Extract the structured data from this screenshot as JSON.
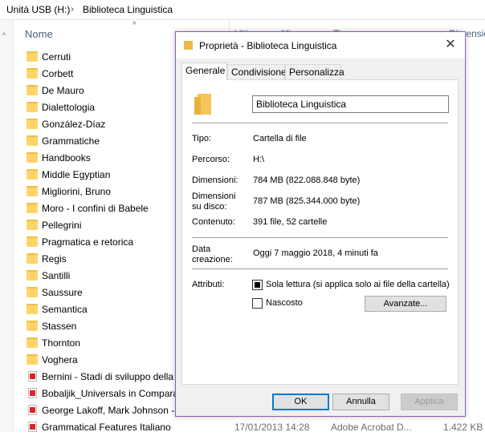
{
  "explorer": {
    "breadcrumb": [
      "Unità USB (H:)",
      "Biblioteca Linguistica"
    ],
    "column_name": "Nome",
    "column_date": "Ultima modifica",
    "column_type": "Tipo",
    "column_size": "Dimensione",
    "folders": [
      "Cerruti",
      "Corbett",
      "De Mauro",
      "Dialettologia",
      "González-Díaz",
      "Grammatiche",
      "Handbooks",
      "Middle Egyptian",
      "Migliorini, Bruno",
      "Moro - I confini di Babele",
      "Pellegrini",
      "Pragmatica e retorica",
      "Regis",
      "Santilli",
      "Saussure",
      "Semantica",
      "Stassen",
      "Thornton",
      "Voghera"
    ],
    "files": [
      {
        "name": "Bernini - Stadi di sviluppo della",
        "date": "",
        "type": "",
        "size": "KB"
      },
      {
        "name": "Bobaljik_Universals in Compara",
        "date": "",
        "type": "",
        "size": "KB"
      },
      {
        "name": "George Lakoff, Mark Johnson -",
        "date": "",
        "type": "",
        "size": "KB"
      },
      {
        "name": "Grammatical Features Italiano",
        "date": "17/01/2013 14:28",
        "type": "Adobe Acrobat D...",
        "size": "1.422 KB"
      }
    ]
  },
  "dialog": {
    "title": "Proprietà - Biblioteca Linguistica",
    "close": "✕",
    "tabs": [
      "Generale",
      "Condivisione",
      "Personalizza"
    ],
    "folder_name": "Biblioteca Linguistica",
    "type_label": "Tipo:",
    "type_value": "Cartella di file",
    "path_label": "Percorso:",
    "path_value": "H:\\",
    "size_label": "Dimensioni:",
    "size_value": "784 MB (822.088.848 byte)",
    "disk_label_1": "Dimensioni",
    "disk_label_2": "su disco:",
    "disk_value": "787 MB (825.344.000 byte)",
    "content_label": "Contenuto:",
    "content_value": "391 file, 52 cartelle",
    "created_label_1": "Data",
    "created_label_2": "creazione:",
    "created_value": "Oggi 7 maggio 2018, 4 minuti fa",
    "attr_label": "Attributi:",
    "readonly_label": "Sola lettura (si applica solo ai file della cartella)",
    "readonly_checked": true,
    "hidden_label": "Nascosto",
    "hidden_checked": false,
    "advanced_button": "Avanzate...",
    "ok_button": "OK",
    "cancel_button": "Annulla",
    "apply_button": "Applica"
  }
}
